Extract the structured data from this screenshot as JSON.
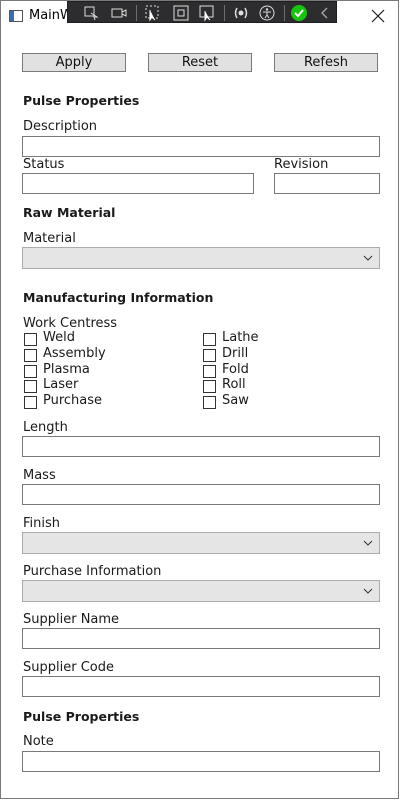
{
  "window": {
    "title": "MainW"
  },
  "debug_toolbar": {
    "icons": [
      "select-element-icon",
      "camera-icon",
      "pointer-icon",
      "adorner-icon",
      "track-focus-icon",
      "binding-icon",
      "accessibility-icon",
      "check-icon",
      "collapse-icon"
    ]
  },
  "toolbar": {
    "apply_label": "Apply",
    "reset_label": "Reset",
    "refresh_label": "Refesh"
  },
  "pulse_properties": {
    "heading": "Pulse Properties",
    "description_label": "Description",
    "description_value": "",
    "status_label": "Status",
    "status_value": "",
    "revision_label": "Revision",
    "revision_value": ""
  },
  "raw_material": {
    "heading": "Raw Material",
    "material_label": "Material",
    "material_value": ""
  },
  "manufacturing": {
    "heading": "Manufacturing Information",
    "work_centres_label": "Work Centress",
    "work_centres_left": [
      {
        "label": "Weld",
        "checked": false
      },
      {
        "label": "Assembly",
        "checked": false
      },
      {
        "label": "Plasma",
        "checked": false
      },
      {
        "label": "Laser",
        "checked": false
      },
      {
        "label": "Purchase",
        "checked": false
      }
    ],
    "work_centres_right": [
      {
        "label": "Lathe",
        "checked": false
      },
      {
        "label": "Drill",
        "checked": false
      },
      {
        "label": "Fold",
        "checked": false
      },
      {
        "label": "Roll",
        "checked": false
      },
      {
        "label": "Saw",
        "checked": false
      }
    ],
    "length_label": "Length",
    "length_value": "",
    "mass_label": "Mass",
    "mass_value": "",
    "finish_label": "Finish",
    "finish_value": "",
    "purchase_info_label": "Purchase Information",
    "purchase_info_value": "",
    "supplier_name_label": "Supplier Name",
    "supplier_name_value": "",
    "supplier_code_label": "Supplier Code",
    "supplier_code_value": ""
  },
  "pulse_properties_2": {
    "heading": "Pulse Properties",
    "note_label": "Note",
    "note_value": ""
  }
}
